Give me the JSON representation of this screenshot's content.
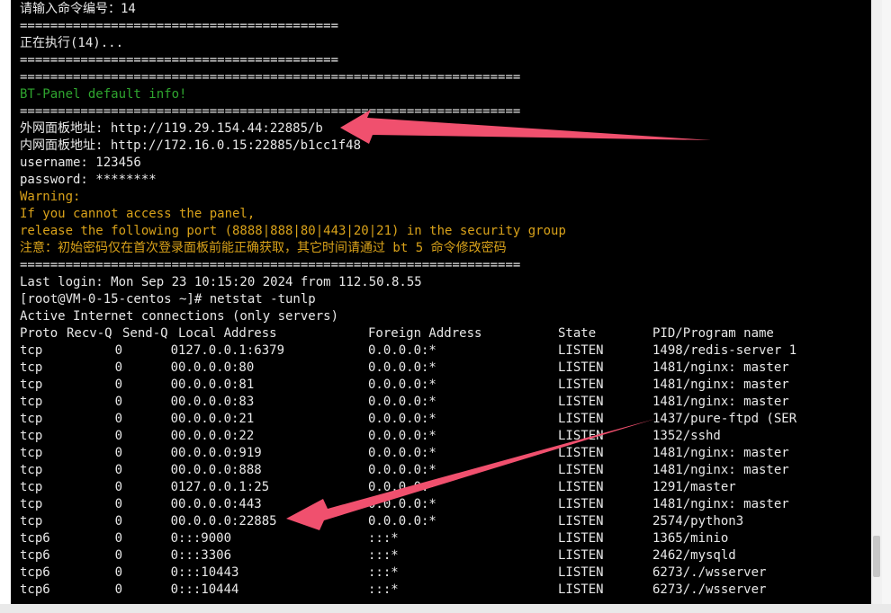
{
  "terminal_lines": [
    {
      "text": "请输入命令编号：14",
      "color": "white"
    },
    {
      "text": "==========================================",
      "color": "white"
    },
    {
      "text": "正在执行(14)...",
      "color": "white"
    },
    {
      "text": "==========================================",
      "color": "white"
    },
    {
      "text": "==================================================================",
      "color": "white"
    },
    {
      "text": "BT-Panel default info!",
      "color": "green"
    },
    {
      "text": "==================================================================",
      "color": "white"
    },
    {
      "text": "外网面板地址: http://119.29.154.44:22885/b",
      "color": "white"
    },
    {
      "text": "内网面板地址: http://172.16.0.15:22885/b1cc1f48",
      "color": "white"
    },
    {
      "text": "username: 123456",
      "color": "white"
    },
    {
      "text": "password: ********",
      "color": "white"
    },
    {
      "text": "Warning:",
      "color": "orange"
    },
    {
      "text": "If you cannot access the panel,",
      "color": "orange"
    },
    {
      "text": "release the following port (8888|888|80|443|20|21) in the security group",
      "color": "orange"
    },
    {
      "text": "注意：初始密码仅在首次登录面板前能正确获取，其它时间请通过 bt 5 命令修改密码",
      "color": "orange"
    },
    {
      "text": "==================================================================",
      "color": "white"
    },
    {
      "text": "Last login: Mon Sep 23 10:15:20 2024 from 112.50.8.55",
      "color": "white"
    },
    {
      "text": "[root@VM-0-15-centos ~]# netstat -tunlp",
      "color": "white"
    },
    {
      "text": "Active Internet connections (only servers)",
      "color": "white"
    }
  ],
  "netstat": {
    "headers": [
      "Proto",
      "Recv-Q",
      "Send-Q",
      "Local Address",
      "Foreign Address",
      "State",
      "PID/Program name"
    ],
    "rows": [
      [
        "tcp",
        "0",
        "0",
        "127.0.0.1:6379",
        "0.0.0.0:*",
        "LISTEN",
        "1498/redis-server 1"
      ],
      [
        "tcp",
        "0",
        "0",
        "0.0.0.0:80",
        "0.0.0.0:*",
        "LISTEN",
        "1481/nginx: master"
      ],
      [
        "tcp",
        "0",
        "0",
        "0.0.0.0:81",
        "0.0.0.0:*",
        "LISTEN",
        "1481/nginx: master"
      ],
      [
        "tcp",
        "0",
        "0",
        "0.0.0.0:83",
        "0.0.0.0:*",
        "LISTEN",
        "1481/nginx: master"
      ],
      [
        "tcp",
        "0",
        "0",
        "0.0.0.0:21",
        "0.0.0.0:*",
        "LISTEN",
        "1437/pure-ftpd (SER"
      ],
      [
        "tcp",
        "0",
        "0",
        "0.0.0.0:22",
        "0.0.0.0:*",
        "LISTEN",
        "1352/sshd"
      ],
      [
        "tcp",
        "0",
        "0",
        "0.0.0.0:919",
        "0.0.0.0:*",
        "LISTEN",
        "1481/nginx: master"
      ],
      [
        "tcp",
        "0",
        "0",
        "0.0.0.0:888",
        "0.0.0.0:*",
        "LISTEN",
        "1481/nginx: master"
      ],
      [
        "tcp",
        "0",
        "0",
        "127.0.0.1:25",
        "0.0.0.0:*",
        "LISTEN",
        "1291/master"
      ],
      [
        "tcp",
        "0",
        "0",
        "0.0.0.0:443",
        "0.0.0.0:*",
        "LISTEN",
        "1481/nginx: master"
      ],
      [
        "tcp",
        "0",
        "0",
        "0.0.0.0:22885",
        "0.0.0.0:*",
        "LISTEN",
        "2574/python3"
      ],
      [
        "tcp6",
        "0",
        "0",
        ":::9000",
        ":::*",
        "LISTEN",
        "1365/minio"
      ],
      [
        "tcp6",
        "0",
        "0",
        ":::3306",
        ":::*",
        "LISTEN",
        "2462/mysqld"
      ],
      [
        "tcp6",
        "0",
        "0",
        ":::10443",
        ":::*",
        "LISTEN",
        "6273/./wsserver"
      ],
      [
        "tcp6",
        "0",
        "0",
        ":::10444",
        ":::*",
        "LISTEN",
        "6273/./wsserver"
      ]
    ]
  },
  "colors": {
    "terminal_bg": "#000000",
    "text_white": "#e8e8e8",
    "text_green": "#2fa52f",
    "text_orange": "#d9a21a",
    "annotation_arrow": "#f0506e"
  }
}
